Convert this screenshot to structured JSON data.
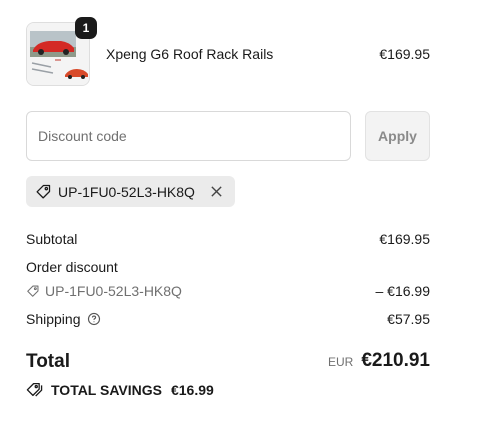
{
  "line_item": {
    "quantity": "1",
    "name": "Xpeng G6 Roof Rack Rails",
    "price": "€169.95",
    "thumbnail_icon": "product-thumbnail"
  },
  "discount": {
    "placeholder": "Discount code",
    "value": "",
    "apply_label": "Apply"
  },
  "applied_code": {
    "code": "UP-1FU0-52L3-HK8Q",
    "tag_icon": "tag-icon",
    "remove_icon": "close-icon"
  },
  "summary": {
    "subtotal_label": "Subtotal",
    "subtotal_value": "€169.95",
    "order_discount_label": "Order discount",
    "order_discount_code": "UP-1FU0-52L3-HK8Q",
    "order_discount_value": "– €16.99",
    "shipping_label": "Shipping",
    "shipping_info_icon": "help-circle-icon",
    "shipping_value": "€57.95"
  },
  "total": {
    "label": "Total",
    "currency": "EUR",
    "amount": "€210.91"
  },
  "savings": {
    "icon": "tags-icon",
    "label": "TOTAL SAVINGS",
    "amount": "€16.99"
  },
  "colors": {
    "text": "#1a1a1a",
    "muted": "#707070",
    "tag_bg": "#ebebeb",
    "badge_bg": "#1a1a1a",
    "apply_bg": "#f3f3f3"
  }
}
